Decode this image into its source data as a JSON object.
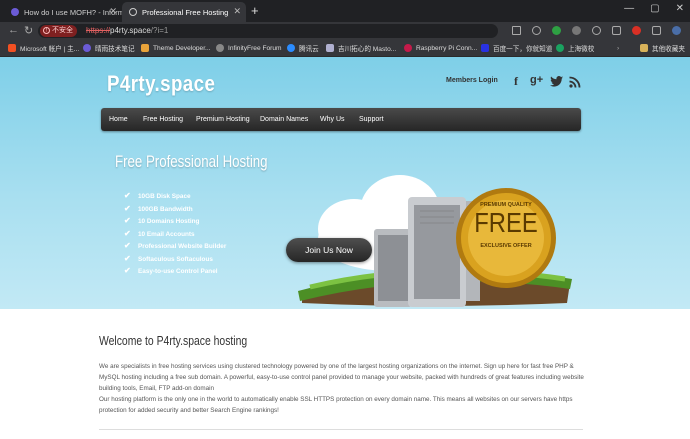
{
  "browser": {
    "tabs": [
      {
        "title": "How do I use MOFH? - Informal",
        "active": false
      },
      {
        "title": "Professional Free Hosting",
        "active": true
      }
    ],
    "security_label": "不安全",
    "url_protocol": "https://",
    "url_host": "p4rty.space",
    "url_path": "/?i=1",
    "bookmarks": [
      {
        "label": "Microsoft 帐户 | 主...",
        "color": "#f25022"
      },
      {
        "label": "晴雨技术笔记",
        "color": "#6b5bd6"
      },
      {
        "label": "Theme Developer...",
        "color": "#e8a33a"
      },
      {
        "label": "InfinityFree Forum",
        "color": "#888888"
      },
      {
        "label": "腾讯云",
        "color": "#2b8cff"
      },
      {
        "label": "吉川拓心的 Masto...",
        "color": "#b0b0d0"
      },
      {
        "label": "Raspberry Pi Conn...",
        "color": "#c51a4a"
      },
      {
        "label": "百度一下，你就知道",
        "color": "#2932e1"
      },
      {
        "label": "上海微校",
        "color": "#1aa260"
      }
    ],
    "other_bookmarks": "其他收藏夹"
  },
  "site": {
    "logo": "P4rty.space",
    "members_login": "Members Login",
    "social": [
      "f",
      "g+",
      "twitter-icon",
      "rss-icon"
    ],
    "menu": [
      "Home",
      "Free Hosting",
      "Premium Hosting",
      "Domain Names",
      "Why Us",
      "Support"
    ],
    "hero_title": "Free Professional Hosting",
    "features": [
      "10GB Disk Space",
      "100GB Bandwidth",
      "10 Domains Hosting",
      "10 Email Accounts",
      "Professional Website Builder",
      "Softaculous Softaculous",
      "Easy-to-use Control Panel"
    ],
    "join_button": "Join Us Now",
    "badge": {
      "top": "PREMIUM QUALITY",
      "main": "FREE",
      "bottom": "EXCLUSIVE OFFER"
    },
    "welcome_title": "Welcome to P4rty.space hosting",
    "paragraph1": "We are specialists in free hosting services using clustered technology powered by one of the largest hosting organizations on the internet. Sign up here for fast free PHP & MySQL hosting including a free sub domain. A powerful, easy-to-use control panel provided to manage your website, packed with hundreds of great features including website building tools, Email, FTP add-on domain",
    "paragraph2": "Our hosting platform is the only one in the world to automatically enable SSL HTTPS protection on every domain name. This means all websites on our servers have https protection for added security and better Search Engine rankings!"
  },
  "colors": {
    "hero_sky": "#8fd6ec",
    "menubar": "#333333",
    "badge_gold": "#d9a21f",
    "insecure_red": "#7f2020"
  }
}
